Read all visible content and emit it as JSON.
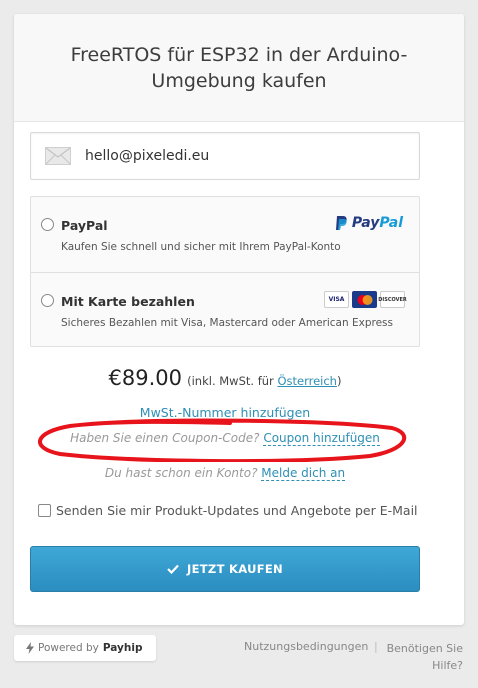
{
  "header": {
    "title": "FreeRTOS für ESP32 in der Arduino-Umgebung kaufen"
  },
  "email": {
    "value": "hello@pixeledi.eu",
    "icon": "envelope-icon"
  },
  "payment": {
    "paypal": {
      "label": "PayPal",
      "description": "Kaufen Sie schnell und sicher mit Ihrem PayPal-Konto",
      "logo_part1": "Pay",
      "logo_part2": "Pal"
    },
    "card": {
      "label": "Mit Karte bezahlen",
      "description": "Sicheres Bezahlen mit Visa, Mastercard oder American Express",
      "visa": "VISA",
      "discover": "DISCOVER"
    }
  },
  "price": {
    "amount": "€89.00",
    "note_prefix": "(inkl. MwSt. für ",
    "country": "Österreich",
    "note_suffix": ")"
  },
  "vat": {
    "link": "MwSt.-Nummer hinzufügen"
  },
  "coupon": {
    "question": "Haben Sie einen Coupon-Code?",
    "link": "Coupon hinzufügen"
  },
  "login": {
    "question": "Du hast schon ein Konto?",
    "link": "Melde dich an"
  },
  "newsletter": {
    "label": "Senden Sie mir Produkt-Updates und Angebote per E-Mail"
  },
  "buy": {
    "label": "JETZT KAUFEN"
  },
  "footer": {
    "powered_prefix": "Powered by",
    "powered_brand": "Payhip",
    "terms": "Nutzungsbedingungen",
    "separator": "|",
    "help": "Benötigen Sie Hilfe?"
  },
  "colors": {
    "accent": "#2e8fb4",
    "button": "#3fa8d6",
    "annotation": "#e8141c"
  }
}
